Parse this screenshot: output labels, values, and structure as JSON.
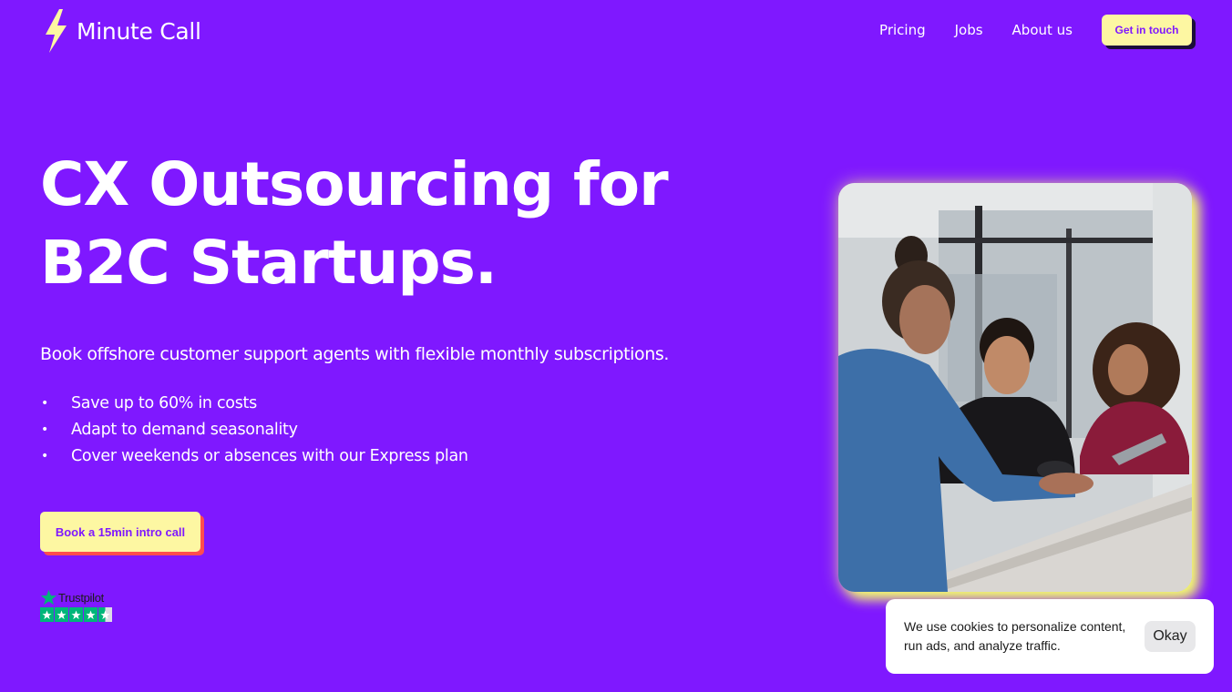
{
  "header": {
    "logo_text": "Minute Call",
    "nav": [
      "Pricing",
      "Jobs",
      "About us"
    ],
    "cta_label": "Get in touch"
  },
  "hero": {
    "title_line1": "CX Outsourcing for",
    "title_line2": "B2C Startups.",
    "subtitle": "Book offshore customer support agents with flexible monthly subscriptions.",
    "bullets": [
      "Save up to 60% in costs",
      "Adapt to demand seasonality",
      "Cover weekends or absences with our Express plan"
    ],
    "book_button_label": "Book a 15min intro call"
  },
  "trustpilot": {
    "name": "Trustpilot",
    "rating_stars": 4.5,
    "icon": "star-icon"
  },
  "photo": {
    "icon": "team-photo"
  },
  "cookie_banner": {
    "text": "We use cookies to personalize content, run ads, and analyze traffic.",
    "button_label": "Okay"
  },
  "colors": {
    "background": "#7f18ff",
    "accent_yellow": "#fdf7a2",
    "trustpilot_green": "#00b67a"
  }
}
